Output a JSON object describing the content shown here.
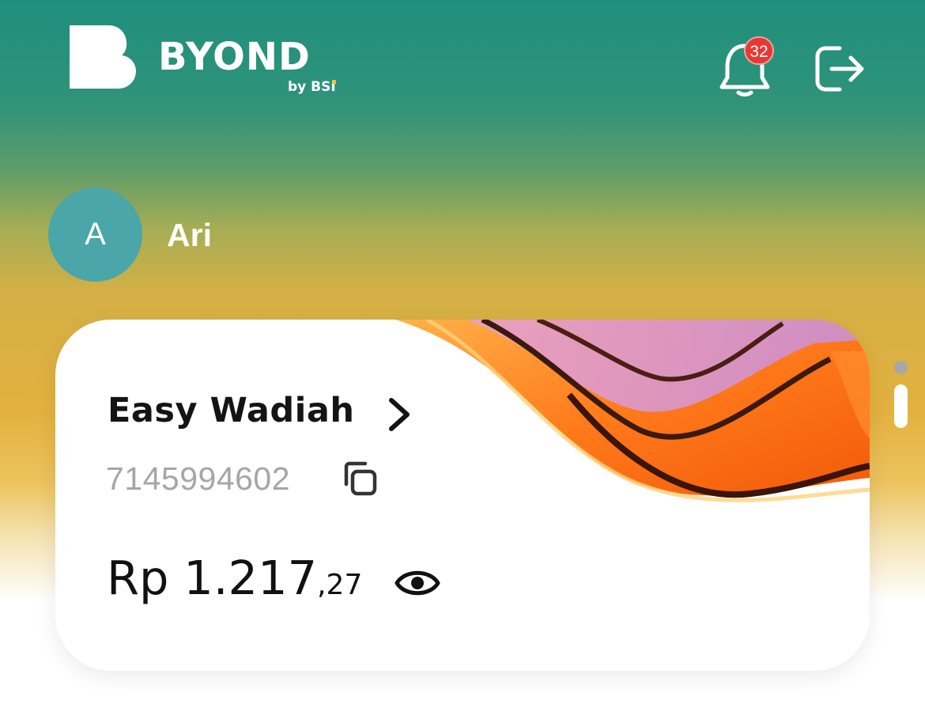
{
  "header": {
    "brand": "BYOND",
    "brand_byline": "by BSI",
    "notification_count": "32",
    "icons": [
      "bell-icon",
      "logout-icon"
    ]
  },
  "profile": {
    "initial": "A",
    "name": "Ari"
  },
  "account_card": {
    "product": "Easy Wadiah",
    "account_number": "7145994602",
    "balance_main": "Rp 1.217",
    "balance_decimal": ",27",
    "icons": [
      "chevron-right-icon",
      "copy-icon",
      "eye-icon"
    ]
  },
  "pager": {
    "pages": 2,
    "active": 2
  },
  "colors": {
    "avatar": "#4aa6a8",
    "badge": "#e53935",
    "gradient_top": "#1f8f7d",
    "gradient_mid": "#e3b13f"
  }
}
